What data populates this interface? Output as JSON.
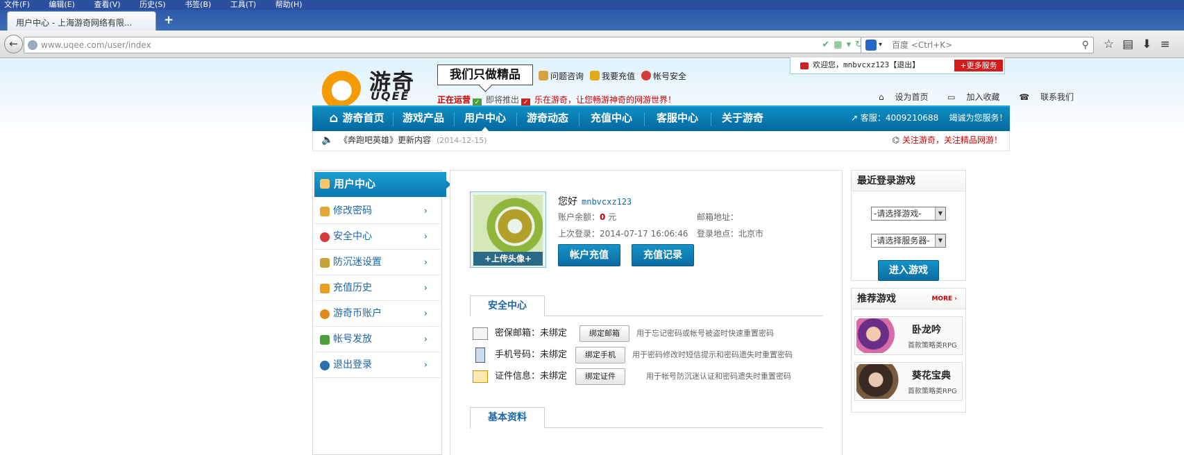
{
  "browser": {
    "menu": [
      "文件(F)",
      "编辑(E)",
      "查看(V)",
      "历史(S)",
      "书签(B)",
      "工具(T)",
      "帮助(H)"
    ],
    "tab_title": "用户中心 - 上海游奇网络有限...",
    "new_tab": "+",
    "url_host": "www.uqee.com",
    "url_path": "/user/index",
    "search_engine": "百度",
    "search_placeholder": "<Ctrl+K>"
  },
  "site": {
    "logo_cn": "游奇",
    "logo_en": "UQEE",
    "slogan": "我们只做精品",
    "quick_links": [
      "问题咨询",
      "我要充值",
      "帐号安全"
    ],
    "status_running": "正在运营",
    "status_coming": "即将推出",
    "status_msg": "乐在游奇，让您畅游神奇的网游世界！",
    "welcome": "欢迎您，mnbvcxz123【退出】",
    "more_service": "+更多服务",
    "top_links": [
      "设为首页",
      "加入收藏",
      "联系我们"
    ],
    "nav": [
      "游奇首页",
      "游戏产品",
      "用户中心",
      "游奇动态",
      "充值中心",
      "客服中心",
      "关于游奇"
    ],
    "nav_active_index": 2,
    "hotline": "客服：4009210688",
    "hotline_tag": "竭诚为您服务！",
    "news_title": "《奔跑吧英雄》更新内容",
    "news_date": "(2014-12-15)",
    "follow": "关注游奇，关注精品网游！"
  },
  "sidebar": {
    "header": "用户中心",
    "items": [
      {
        "label": "修改密码",
        "color": "#e0a83a"
      },
      {
        "label": "安全中心",
        "color": "#d63b3b"
      },
      {
        "label": "防沉迷设置",
        "color": "#c9a23a"
      },
      {
        "label": "充值历史",
        "color": "#e6a01e"
      },
      {
        "label": "游奇币账户",
        "color": "#e08a1e"
      },
      {
        "label": "帐号发放",
        "color": "#4aa13c"
      },
      {
        "label": "退出登录",
        "color": "#2a6fb0"
      }
    ],
    "arrow": "›"
  },
  "profile": {
    "upload_avatar": "+上传头像+",
    "greeting": "您好",
    "username": "mnbvcxz123",
    "balance_label": "账户余额：",
    "balance_value": "0",
    "balance_unit": "元",
    "email_label": "邮箱地址：",
    "last_login_label": "上次登录：",
    "last_login_value": "2014-07-17 16:06:46",
    "login_place_label": "登录地点：",
    "login_place_value": "北京市",
    "recharge_btn": "帐户充值",
    "records_btn": "充值记录"
  },
  "security": {
    "title": "安全中心",
    "rows": [
      {
        "label": "密保邮箱：",
        "status": "未绑定",
        "button": "绑定邮箱",
        "desc": "用于忘记密码或帐号被盗时快速重置密码"
      },
      {
        "label": "手机号码：",
        "status": "未绑定",
        "button": "绑定手机",
        "desc": "用于密码修改时短信提示和密码遗失时重置密码"
      },
      {
        "label": "证件信息：",
        "status": "未绑定",
        "button": "绑定证件",
        "desc": "用于帐号防沉迷认证和密码遗失时重置密码"
      }
    ]
  },
  "basic_info": {
    "title": "基本资料"
  },
  "recent_games": {
    "title": "最近登录游戏",
    "select_game": "-请选择游戏-",
    "select_server": "-请选择服务器-",
    "enter_btn": "进入游戏"
  },
  "recommend": {
    "title": "推荐游戏",
    "more": "MORE ›",
    "games": [
      {
        "name": "卧龙吟",
        "desc": "首款策略类RPG"
      },
      {
        "name": "葵花宝典",
        "desc": "首款策略类RPG"
      }
    ]
  }
}
